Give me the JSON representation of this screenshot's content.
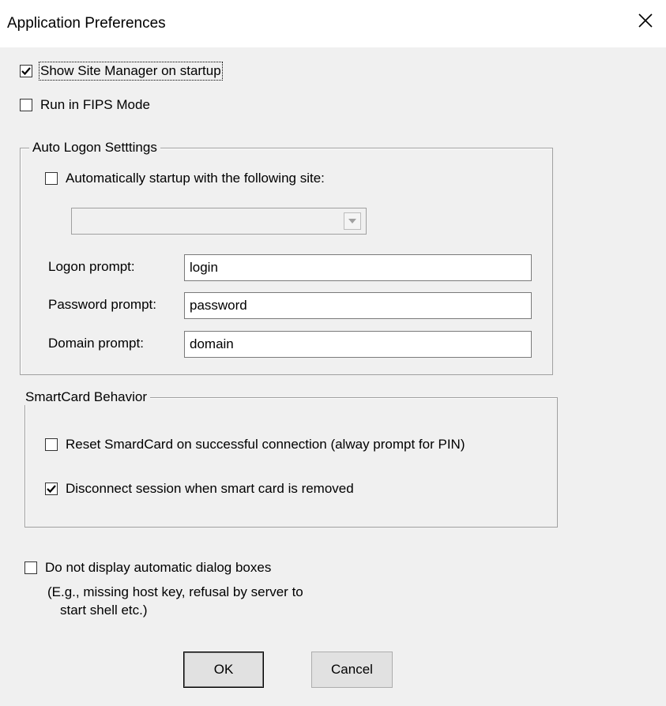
{
  "window": {
    "title": "Application Preferences"
  },
  "options": {
    "show_site_manager": {
      "label": "Show Site Manager on startup",
      "checked": true
    },
    "fips_mode": {
      "label": "Run in FIPS Mode",
      "checked": false
    }
  },
  "auto_logon": {
    "group_label": "Auto Logon Setttings",
    "auto_startup": {
      "label": "Automatically startup with the following site:",
      "checked": false
    },
    "site_select": {
      "value": ""
    },
    "logon_prompt": {
      "label": "Logon prompt:",
      "value": "login"
    },
    "password_prompt": {
      "label": "Password prompt:",
      "value": "password"
    },
    "domain_prompt": {
      "label": "Domain prompt:",
      "value": "domain"
    }
  },
  "smartcard": {
    "group_label": "SmartCard Behavior",
    "reset": {
      "label": "Reset SmardCard on successful connection (alway prompt for PIN)",
      "checked": false
    },
    "disconnect": {
      "label": "Disconnect session when smart card is removed",
      "checked": true
    }
  },
  "dialogs": {
    "no_auto_dialogs": {
      "label": "Do not display automatic dialog boxes",
      "checked": false
    },
    "note_line1": "(E.g., missing host key, refusal by server to",
    "note_line2": "start shell etc.)"
  },
  "buttons": {
    "ok": "OK",
    "cancel": "Cancel"
  },
  "icons": {
    "close": "close-icon",
    "checkmark": "checkmark-icon",
    "dropdown": "chevron-down-icon"
  }
}
